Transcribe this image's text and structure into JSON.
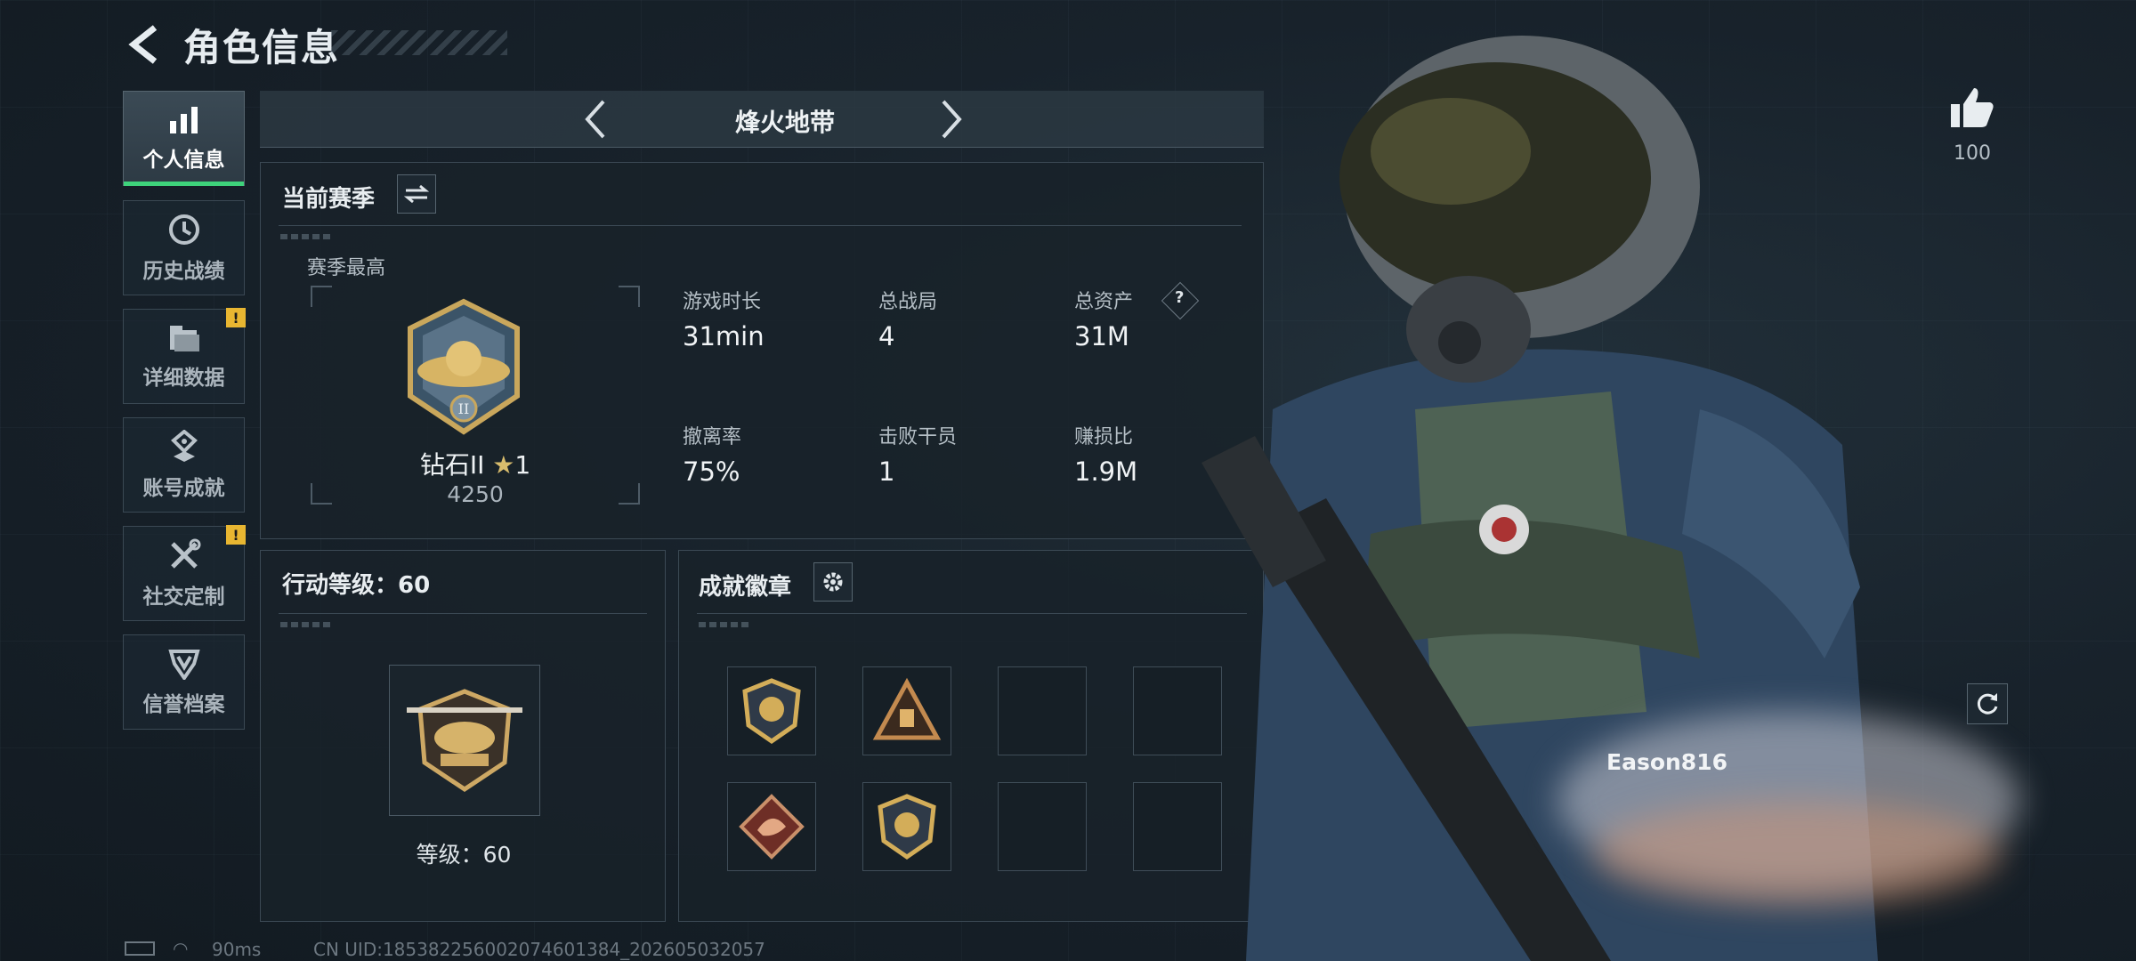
{
  "header": {
    "title": "角色信息"
  },
  "sidebar": {
    "items": [
      {
        "label": "个人信息",
        "active": true,
        "icon": "bar-chart-icon",
        "warning": false
      },
      {
        "label": "历史战绩",
        "active": false,
        "icon": "clock-icon",
        "warning": false
      },
      {
        "label": "详细数据",
        "active": false,
        "icon": "folder-icon",
        "warning": true
      },
      {
        "label": "账号成就",
        "active": false,
        "icon": "trophy-icon",
        "warning": false
      },
      {
        "label": "社交定制",
        "active": false,
        "icon": "tools-icon",
        "warning": true
      },
      {
        "label": "信誉档案",
        "active": false,
        "icon": "shield-badge-icon",
        "warning": false
      }
    ],
    "warning_glyph": "!"
  },
  "mode": {
    "title": "烽火地带"
  },
  "season": {
    "title": "当前赛季",
    "best_label": "赛季最高",
    "rank_name": "钻石II",
    "rank_stars": "1",
    "rank_points": "4250",
    "stats": [
      {
        "label": "游戏时长",
        "value": "31min"
      },
      {
        "label": "总战局",
        "value": "4"
      },
      {
        "label": "总资产",
        "value": "31M",
        "help": "?"
      },
      {
        "label": "撤离率",
        "value": "75%"
      },
      {
        "label": "击败干员",
        "value": "1"
      },
      {
        "label": "赚损比",
        "value": "1.9M"
      }
    ]
  },
  "level": {
    "title": "行动等级：60",
    "level_text": "等级：60"
  },
  "achievements": {
    "title": "成就徽章",
    "slots": [
      "badge-shield",
      "badge-triangle",
      "empty",
      "empty",
      "badge-dragon",
      "badge-shield-2",
      "empty",
      "empty"
    ]
  },
  "right": {
    "likes": "100",
    "player_name": "Eason816"
  },
  "footer": {
    "ping": "90ms",
    "uid": "CN UID:18538225600207460138​4_202605032057"
  },
  "colors": {
    "accent_green": "#3ed37b",
    "warning_yellow": "#e8b631",
    "background": "#18222b"
  }
}
